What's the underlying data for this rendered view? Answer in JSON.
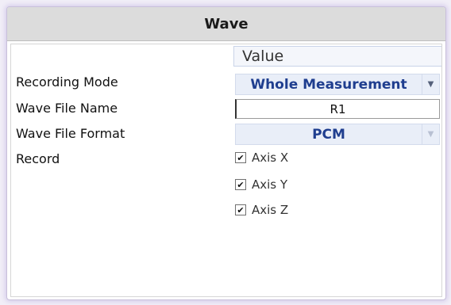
{
  "window": {
    "title": "Wave"
  },
  "grid": {
    "value_header": "Value"
  },
  "rows": {
    "recording_mode": {
      "label": "Recording Mode",
      "value": "Whole Measurement",
      "arrow": "▼"
    },
    "wave_file_name": {
      "label": "Wave File Name",
      "value": "R1"
    },
    "wave_file_format": {
      "label": "Wave File Format",
      "value": "PCM",
      "arrow": "▼"
    },
    "record": {
      "label": "Record",
      "options": [
        {
          "label": "Axis X",
          "checked": true,
          "mark": "✔"
        },
        {
          "label": "Axis Y",
          "checked": true,
          "mark": "✔"
        },
        {
          "label": "Axis Z",
          "checked": true,
          "mark": "✔"
        }
      ]
    }
  },
  "colors": {
    "accent_text": "#1f3e8f",
    "combo_bg": "#e9eef8",
    "title_bg": "#dcdcdc"
  }
}
